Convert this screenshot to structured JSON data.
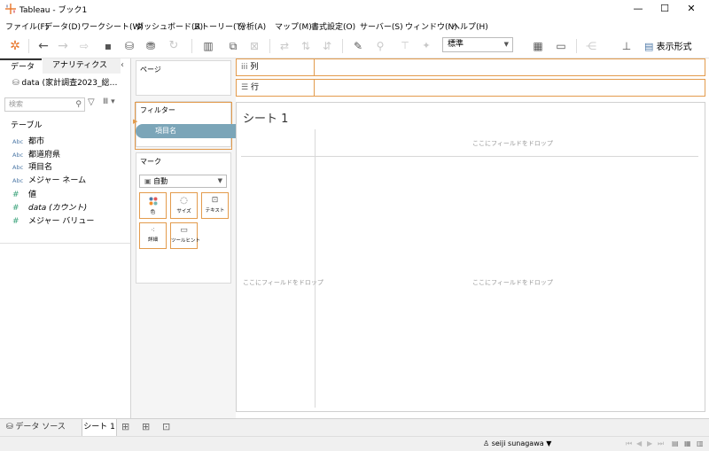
{
  "window": {
    "title": "Tableau - ブック1",
    "controls": [
      "—",
      "☐",
      "✕"
    ]
  },
  "menu": [
    "ファイル(F)",
    "データ(D)",
    "ワークシート(W)",
    "ダッシュボード(B)",
    "ストーリー(T)",
    "分析(A)",
    "マップ(M)",
    "書式設定(O)",
    "サーバー(S)",
    "ウィンドウ(N)",
    "ヘルプ(H)"
  ],
  "toolbar": {
    "fit_value": "標準",
    "show_me_label": "表示形式"
  },
  "datapane": {
    "tab_data": "データ",
    "tab_analytics": "アナリティクス",
    "datasource": "data (家計調査2023_総…",
    "search_placeholder": "検索",
    "tables_label": "テーブル",
    "dimensions": [
      "都市",
      "都道府県",
      "項目名",
      "メジャー ネーム"
    ],
    "dimension_type": "Abc",
    "measures": [
      "値",
      "data (カウント)",
      "メジャー バリュー"
    ],
    "measure_type": "#"
  },
  "shelves": {
    "pages": "ページ",
    "filters": "フィルター",
    "filter_pill": "項目名",
    "marks": "マーク",
    "mark_type": "自動",
    "mark_buttons": [
      "色",
      "サイズ",
      "テキスト",
      "詳細",
      "ツールヒント"
    ],
    "columns": "列",
    "rows": "行"
  },
  "view": {
    "sheet_title": "シート 1",
    "drop_hint": "ここにフィールドをドロップ"
  },
  "bottom": {
    "datasource_tab": "データ ソース",
    "sheet_tab": "シート 1",
    "user": "seiji sunagawa"
  }
}
